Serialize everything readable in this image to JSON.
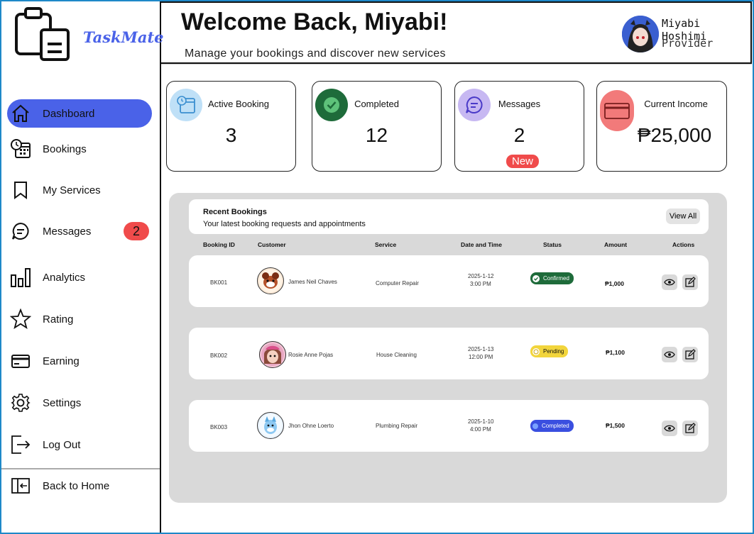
{
  "app": {
    "name": "TaskMate"
  },
  "sidebar": {
    "items": [
      {
        "label": "Dashboard",
        "icon": "home-icon",
        "active": true
      },
      {
        "label": "Bookings",
        "icon": "calendar-clock-icon"
      },
      {
        "label": "My Services",
        "icon": "bookmark-icon"
      },
      {
        "label": "Messages",
        "icon": "chat-icon",
        "badge": "2"
      },
      {
        "label": "Analytics",
        "icon": "bar-chart-icon"
      },
      {
        "label": "Rating",
        "icon": "star-icon"
      },
      {
        "label": "Earning",
        "icon": "credit-card-icon"
      },
      {
        "label": "Settings",
        "icon": "gear-icon"
      },
      {
        "label": "Log Out",
        "icon": "logout-icon"
      }
    ],
    "back_home": "Back to Home",
    "accent": "#4a62e8",
    "badge_color": "#f04b4b"
  },
  "header": {
    "welcome": "Welcome Back, Miyabi!",
    "subtitle": "Manage your bookings and discover new services",
    "user_name": "Miyabi Hoshimi",
    "user_role": "Provider"
  },
  "stats": {
    "active": {
      "label": "Active Booking",
      "value": "3"
    },
    "completed": {
      "label": "Completed",
      "value": "12"
    },
    "messages": {
      "label": "Messages",
      "value": "2",
      "badge": "New"
    },
    "income": {
      "label": "Current Income",
      "value": "₱25,000"
    }
  },
  "bookings": {
    "title": "Recent Bookings",
    "subtitle": "Your latest booking requests and appointments",
    "view_all": "View All",
    "columns": [
      "Booking ID",
      "Customer",
      "Service",
      "Date and Time",
      "Status",
      "Amount",
      "Actions"
    ],
    "rows": [
      {
        "id": "BK001",
        "customer": "James Neil Chaves",
        "service": "Computer Repair",
        "date": "2025-1-12",
        "time": "3:00 PM",
        "status": "Confirmed",
        "amount": "₱1,000"
      },
      {
        "id": "BK002",
        "customer": "Rosie Anne Pojas",
        "service": "House Cleaning",
        "date": "2025-1-13",
        "time": "12:00 PM",
        "status": "Pending",
        "amount": "₱1,100"
      },
      {
        "id": "BK003",
        "customer": "Jhon Ohne Loerto",
        "service": "Plumbing Repair",
        "date": "2025-1-10",
        "time": "4:00 PM",
        "status": "Completed",
        "amount": "₱1,500"
      }
    ],
    "status_colors": {
      "Confirmed": "#1e6b3a",
      "Pending": "#f2d53c",
      "Completed": "#3a4fe0"
    }
  }
}
